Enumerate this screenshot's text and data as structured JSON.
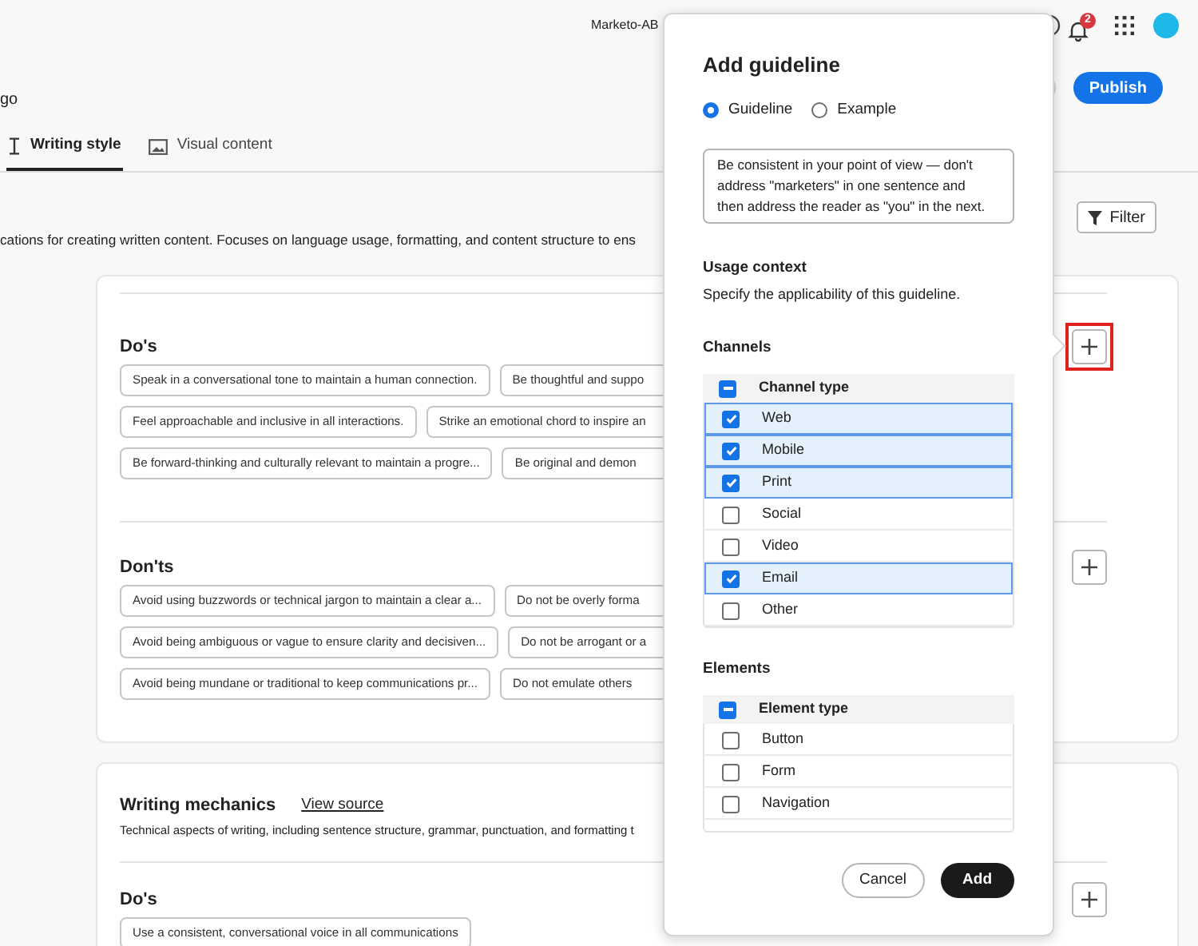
{
  "header": {
    "org": "Marketo-AB",
    "notification_count": "2"
  },
  "toolbar": {
    "title_fragment": "go",
    "publish": "Publish"
  },
  "tabs": [
    {
      "label": "Writing style",
      "kind": "text",
      "selected": true
    },
    {
      "label": "Visual content",
      "kind": "image",
      "selected": false
    }
  ],
  "description": "cations for creating written content. Focuses on language usage, formatting, and content structure to ens",
  "filter": "Filter",
  "cards": [
    {
      "sections": [
        {
          "title": "Do's",
          "highlighted": true,
          "rows": [
            [
              "Speak in a conversational tone to maintain a human connection.",
              "Be thoughtful and suppo"
            ],
            [
              "Feel approachable and inclusive in all interactions.",
              "Strike an emotional chord to inspire an"
            ],
            [
              "Be forward-thinking and culturally relevant to maintain a progre...",
              "Be original and demon"
            ]
          ]
        },
        {
          "title": "Don'ts",
          "highlighted": false,
          "rows": [
            [
              "Avoid using buzzwords or technical jargon to maintain a clear a...",
              "Do not be overly forma"
            ],
            [
              "Avoid being ambiguous or vague to ensure clarity and decisiven...",
              "Do not be arrogant or a"
            ],
            [
              "Avoid being mundane or traditional to keep communications pr...",
              "Do not emulate others"
            ]
          ]
        }
      ]
    },
    {
      "title": "Writing mechanics",
      "link": "View source",
      "description": "Technical aspects of writing, including sentence structure, grammar, punctuation, and formatting t",
      "sections": [
        {
          "title": "Do's",
          "highlighted": false,
          "rows": [
            [
              "Use a consistent, conversational voice in all communications"
            ]
          ]
        }
      ]
    }
  ],
  "dialog": {
    "title": "Add guideline",
    "options": [
      {
        "label": "Guideline",
        "selected": true
      },
      {
        "label": "Example",
        "selected": false
      }
    ],
    "text": "Be consistent in your point of view — don't address \"marketers\" in one sentence and\nthen address the reader as \"you\" in the next.",
    "usage_title": "Usage context",
    "usage_description": "Specify the applicability of this guideline.",
    "groups": [
      {
        "title": "Channels",
        "header": "Channel type",
        "header_indeterminate": true,
        "items": [
          {
            "label": "Web",
            "checked": true
          },
          {
            "label": "Mobile",
            "checked": true
          },
          {
            "label": "Print",
            "checked": true
          },
          {
            "label": "Social",
            "checked": false
          },
          {
            "label": "Video",
            "checked": false
          },
          {
            "label": "Email",
            "checked": true
          },
          {
            "label": "Other",
            "checked": false
          }
        ]
      },
      {
        "title": "Elements",
        "header": "Element type",
        "header_indeterminate": true,
        "items": [
          {
            "label": "Button",
            "checked": false
          },
          {
            "label": "Form",
            "checked": false
          },
          {
            "label": "Navigation",
            "checked": false
          }
        ]
      }
    ],
    "cancel": "Cancel",
    "add": "Add"
  }
}
